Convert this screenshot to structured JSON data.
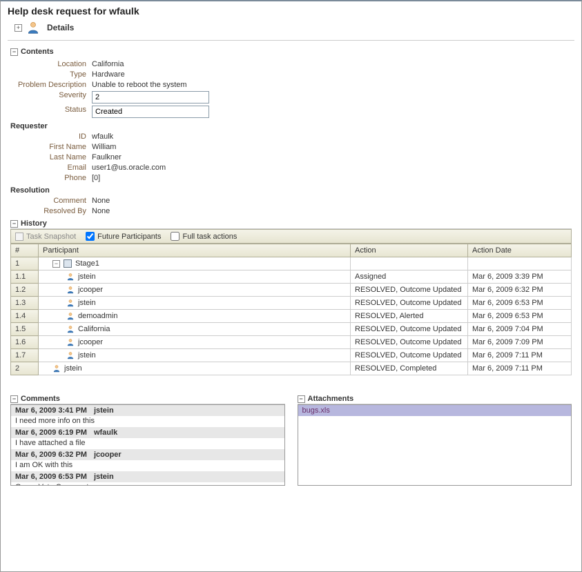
{
  "title": "Help desk request for wfaulk",
  "details_label": "Details",
  "contents": {
    "header": "Contents",
    "location_label": "Location",
    "location_value": "California",
    "type_label": "Type",
    "type_value": "Hardware",
    "problem_label": "Problem Description",
    "problem_value": "Unable to reboot the system",
    "severity_label": "Severity",
    "severity_value": "2",
    "status_label": "Status",
    "status_value": "Created"
  },
  "requester": {
    "header": "Requester",
    "id_label": "ID",
    "id_value": "wfaulk",
    "first_name_label": "First Name",
    "first_name_value": "William",
    "last_name_label": "Last Name",
    "last_name_value": "Faulkner",
    "email_label": "Email",
    "email_value": "user1@us.oracle.com",
    "phone_label": "Phone",
    "phone_value": "[0]"
  },
  "resolution": {
    "header": "Resolution",
    "comment_label": "Comment",
    "comment_value": "None",
    "resolved_by_label": "Resolved By",
    "resolved_by_value": "None"
  },
  "history": {
    "header": "History",
    "task_snapshot": "Task Snapshot",
    "future_participants": "Future Participants",
    "full_task_actions": "Full task actions",
    "col_num": "#",
    "col_participant": "Participant",
    "col_action": "Action",
    "col_action_date": "Action Date",
    "rows": [
      {
        "num": "1",
        "participant": "Stage1",
        "action": "",
        "date": "",
        "indent": 1,
        "type": "stage"
      },
      {
        "num": "1.1",
        "participant": "jstein",
        "action": "Assigned",
        "date": "Mar 6, 2009 3:39 PM",
        "indent": 2,
        "type": "user"
      },
      {
        "num": "1.2",
        "participant": "jcooper",
        "action": "RESOLVED, Outcome Updated",
        "date": "Mar 6, 2009 6:32 PM",
        "indent": 2,
        "type": "user"
      },
      {
        "num": "1.3",
        "participant": "jstein",
        "action": "RESOLVED, Outcome Updated",
        "date": "Mar 6, 2009 6:53 PM",
        "indent": 2,
        "type": "user"
      },
      {
        "num": "1.4",
        "participant": "demoadmin",
        "action": "RESOLVED, Alerted",
        "date": "Mar 6, 2009 6:53 PM",
        "indent": 2,
        "type": "user"
      },
      {
        "num": "1.5",
        "participant": "California",
        "action": "RESOLVED, Outcome Updated",
        "date": "Mar 6, 2009 7:04 PM",
        "indent": 2,
        "type": "user"
      },
      {
        "num": "1.6",
        "participant": "jcooper",
        "action": "RESOLVED, Outcome Updated",
        "date": "Mar 6, 2009 7:09 PM",
        "indent": 2,
        "type": "user"
      },
      {
        "num": "1.7",
        "participant": "jstein",
        "action": "RESOLVED, Outcome Updated",
        "date": "Mar 6, 2009 7:11 PM",
        "indent": 2,
        "type": "user"
      },
      {
        "num": "2",
        "participant": "jstein",
        "action": "RESOLVED, Completed",
        "date": "Mar 6, 2009 7:11 PM",
        "indent": 1,
        "type": "user"
      }
    ]
  },
  "comments": {
    "header": "Comments",
    "items": [
      {
        "date": "Mar 6, 2009 3:41 PM",
        "user": "jstein",
        "text": "I need more info on this"
      },
      {
        "date": "Mar 6, 2009 6:19 PM",
        "user": "wfaulk",
        "text": "I have attached a file"
      },
      {
        "date": "Mar 6, 2009 6:32 PM",
        "user": "jcooper",
        "text": "I am OK with this"
      },
      {
        "date": "Mar 6, 2009 6:53 PM",
        "user": "jstein",
        "text": "Group Vote Comment"
      }
    ]
  },
  "attachments": {
    "header": "Attachments",
    "items": [
      {
        "name": "bugs.xls"
      }
    ]
  },
  "glyphs": {
    "plus": "+",
    "minus": "−"
  }
}
